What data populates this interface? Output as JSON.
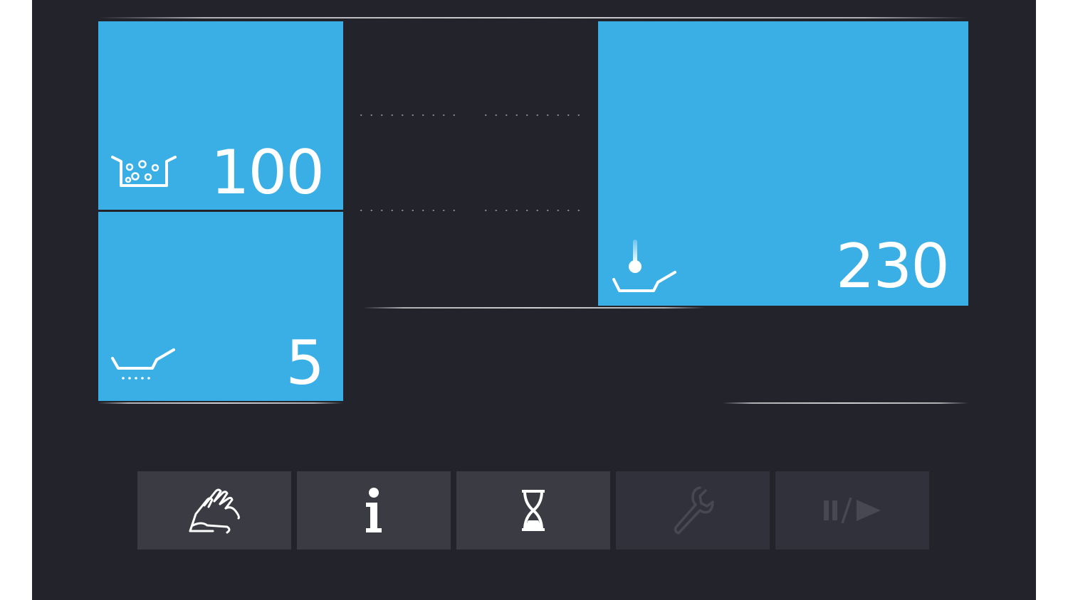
{
  "tiles": {
    "boiling": {
      "value": "100",
      "icon": "boiling-water-icon"
    },
    "pan_level": {
      "value": "5",
      "icon": "pan-level-icon"
    },
    "pan_temperature": {
      "value": "230",
      "icon": "pan-thermometer-icon"
    }
  },
  "toolbar": {
    "buttons": [
      {
        "icon": "hand-cleaning-icon",
        "enabled": true
      },
      {
        "icon": "info-icon",
        "enabled": true
      },
      {
        "icon": "hourglass-icon",
        "enabled": true
      },
      {
        "icon": "wrench-icon",
        "enabled": false
      },
      {
        "icon": "pause-play-icon",
        "enabled": false
      }
    ]
  },
  "colors": {
    "background": "#23232b",
    "tile": "#3aafe6",
    "button": "#3a3b43",
    "button_disabled": "#30313a",
    "icon_active": "#ffffff",
    "icon_disabled": "#474852"
  }
}
